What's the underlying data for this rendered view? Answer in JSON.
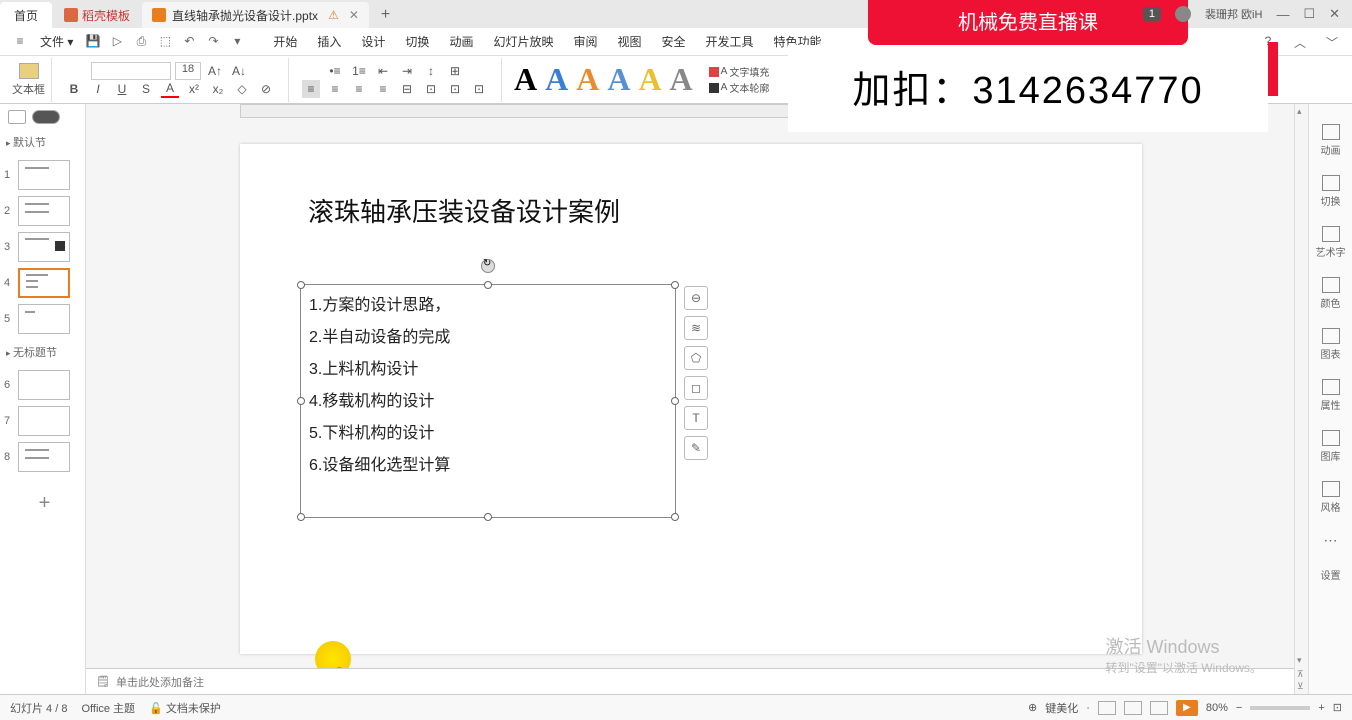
{
  "tabs": {
    "home": "首页",
    "template": "稻壳模板",
    "file": "直线轴承抛光设备设计.pptx"
  },
  "user": {
    "badge": "1",
    "name": "裴珊邦 欧iH"
  },
  "overlay": {
    "top": "机械免费直播课",
    "bottom": "加扣：3142634770"
  },
  "menu": {
    "file": "文件",
    "tabs": [
      "开始",
      "插入",
      "设计",
      "切换",
      "动画",
      "幻灯片放映",
      "审阅",
      "视图",
      "安全",
      "开发工具",
      "特色功能"
    ]
  },
  "toolbar": {
    "textbox_label": "文本框",
    "font_size": "18",
    "format_a": "A",
    "fill_label": "文字填充",
    "outline_label": "文本轮廓"
  },
  "sections": {
    "s1": "默认节",
    "s2": "无标题节"
  },
  "slide": {
    "title": "滚珠轴承压装设备设计案例",
    "lines": [
      "1.方案的设计思路，",
      "2.半自动设备的完成",
      "3.上料机构设计",
      "4.移载机构的设计",
      "5.下料机构的设计",
      "6.设备细化选型计算"
    ]
  },
  "right_panel": [
    "动画",
    "切换",
    "艺术字",
    "颜色",
    "图表",
    "属性",
    "图库",
    "风格",
    "",
    "设置"
  ],
  "notes": "单击此处添加备注",
  "status": {
    "page": "幻灯片 4 / 8",
    "theme": "Office 主题",
    "protect": "文档未保护",
    "beautify": "键美化",
    "zoom": "80%"
  },
  "watermark": {
    "l1": "激活 Windows",
    "l2": "转到\"设置\"以激活 Windows。"
  }
}
